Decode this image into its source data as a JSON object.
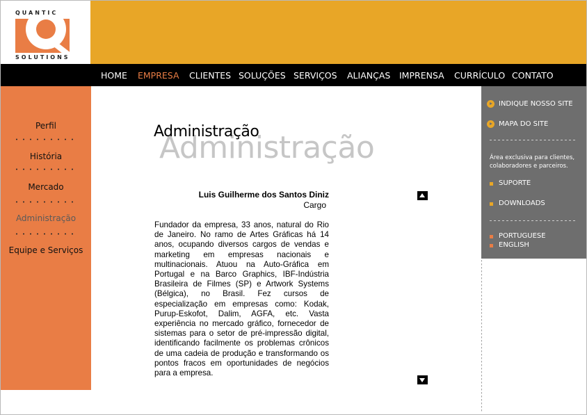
{
  "brand": {
    "name_top": "QUANTIC",
    "name_bottom": "SOLUTIONS",
    "colors": {
      "orange": "#e97d45",
      "gold": "#e8a627",
      "gray": "#6e6e6e",
      "black": "#000000"
    }
  },
  "nav": {
    "items": [
      {
        "label": "HOME",
        "active": false
      },
      {
        "label": "EMPRESA",
        "active": true
      },
      {
        "label": "CLIENTES",
        "active": false
      },
      {
        "label": "SOLUÇÕES",
        "active": false
      },
      {
        "label": "SERVIÇOS",
        "active": false
      },
      {
        "label": "ALIANÇAS",
        "active": false
      },
      {
        "label": "IMPRENSA",
        "active": false
      },
      {
        "label": "CURRÍCULO",
        "active": false
      },
      {
        "label": "CONTATO",
        "active": false
      }
    ]
  },
  "left_menu": {
    "items": [
      {
        "label": "Perfil",
        "active": false
      },
      {
        "label": "História",
        "active": false
      },
      {
        "label": "Mercado",
        "active": false
      },
      {
        "label": "Administração",
        "active": true
      },
      {
        "label": "Equipe e Serviços",
        "active": false
      }
    ]
  },
  "main": {
    "title": "Administração",
    "title_shadow": "Administração",
    "person": {
      "name": "Luis Guilherme dos Santos Diniz",
      "role": "Cargo",
      "bio": "Fundador da empresa, 33 anos, natural do Rio de Janeiro. No ramo de Artes Gráficas há 14 anos, ocupando diversos cargos de vendas e marketing em empresas nacionais e multinacionais. Atuou na Auto-Gráfica em Portugal e na Barco Graphics, IBF-Indústria Brasileira de Filmes (SP) e Artwork Systems (Bélgica), no Brasil. Fez cursos de especialização em empresas como: Kodak, Purup-Eskofot, Dalim, AGFA, etc. Vasta experiência no mercado gráfico, fornecedor de sistemas para o setor de pré-impressão digital, identificando facilmente os problemas crônicos de uma cadeia de produção e transformando os pontos fracos em oportunidades de negócios para a empresa."
    }
  },
  "right_panel": {
    "indique": "INDIQUE NOSSO SITE",
    "mapa": "MAPA DO SITE",
    "note": "Área exclusiva para clientes, colaboradores e parceiros.",
    "suporte": "SUPORTE",
    "downloads": "DOWNLOADS",
    "portuguese": "PORTUGUESE",
    "english": "ENGLISH"
  }
}
